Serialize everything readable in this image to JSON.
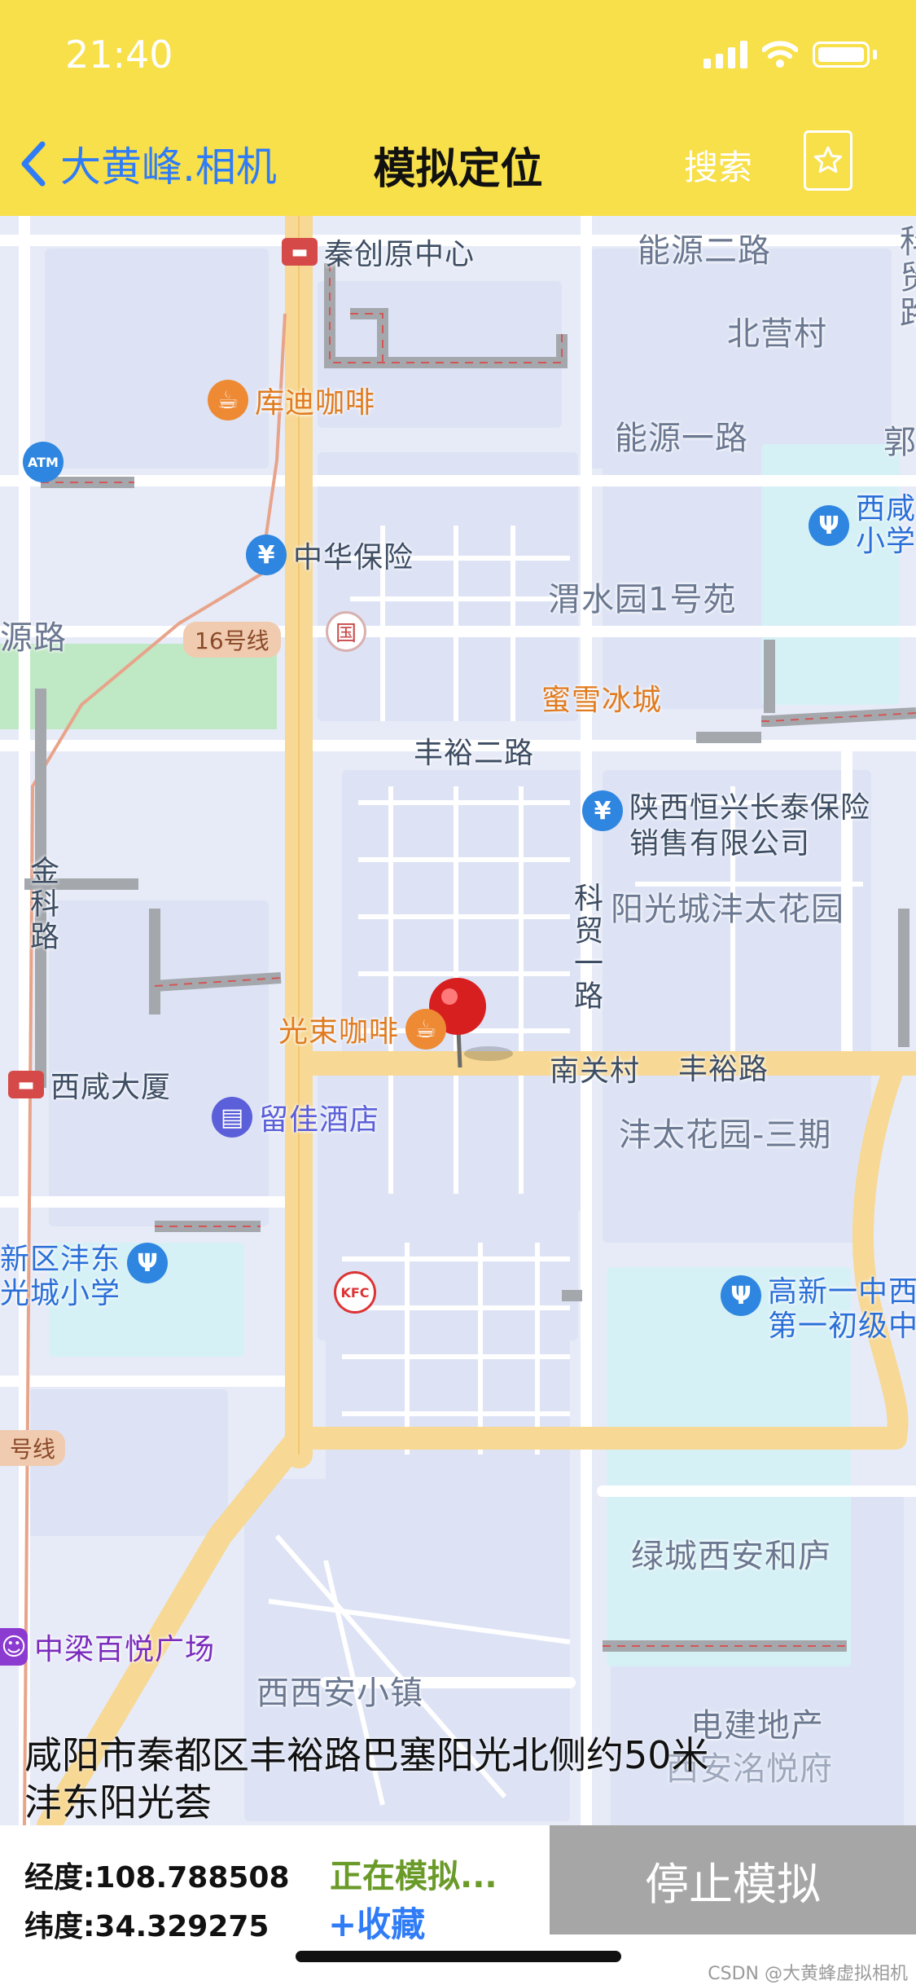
{
  "status_bar": {
    "time": "21:40"
  },
  "nav": {
    "back_label": "大黄峰.相机",
    "title": "模拟定位",
    "search_label": "搜索",
    "favorite_icon": "star-icon"
  },
  "map": {
    "labels": {
      "qinchuangyuan": "秦创原中心",
      "nengyuan2": "能源二路",
      "keji": "科贸路",
      "beiying": "北营村",
      "kudi": "库迪咖啡",
      "nengyuan1": "能源一路",
      "guo": "郭",
      "xixian_school": "西咸小学",
      "zhonghua": "中华保险",
      "weishui": "渭水园1号苑",
      "yuan_road": "源路",
      "line16": "16号线",
      "mixue": "蜜雪冰城",
      "fengyu2": "丰裕二路",
      "hengxing": "陕西恒兴长泰保险",
      "hengxing2": "销售有限公司",
      "jinke": "金科路",
      "kemao1": "科贸一路",
      "yangguang": "阳光城沣太花园",
      "guangshu": "光束咖啡",
      "nanguan": "南关村",
      "fengyu": "丰裕路",
      "xixian_building": "西咸大厦",
      "liujia": "留佳酒店",
      "fengtai3": "沣太花园-三期",
      "fengdong_school1": "新区沣东",
      "fengdong_school2": "光城小学",
      "gaoxin1": "高新一中西",
      "gaoxin2": "第一初级中",
      "hao_line": "号线",
      "lvcheng": "绿城西安和庐",
      "zhongliang": "中梁百悦广场",
      "xixian_town": "西西安小镇",
      "dianjian": "电建地产",
      "dianjian2": "西安洺悦府",
      "kfc": "KFC",
      "atm": "ATM"
    }
  },
  "address": {
    "line1": "咸阳市秦都区丰裕路巴塞阳光北侧约50米",
    "line2": "沣东阳光荟"
  },
  "bottom": {
    "longitude": "经度:108.788508",
    "latitude": "纬度:34.329275",
    "status": "正在模拟...",
    "favorite": "+收藏",
    "stop_button": "停止模拟"
  },
  "watermark": "CSDN @大黄蜂虚拟相机"
}
